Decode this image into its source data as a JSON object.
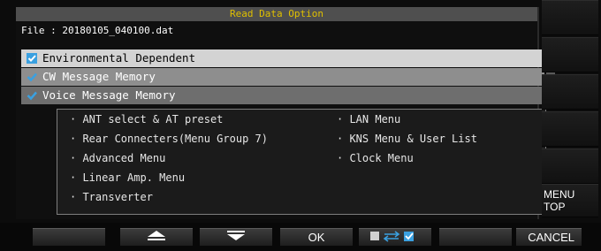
{
  "dialog": {
    "title": "Read Data Option",
    "file_line": "File : 20180105_040100.dat",
    "options": [
      {
        "label": "Environmental Dependent",
        "checked": true
      },
      {
        "label": "CW Message Memory",
        "checked": true
      },
      {
        "label": "Voice Message Memory",
        "checked": true
      }
    ],
    "info_items": [
      "· ANT select & AT preset",
      "· Rear Connecters(Menu Group 7)",
      "· Advanced Menu",
      "· Linear Amp. Menu",
      "· Transverter",
      "· LAN Menu",
      "· KNS Menu & User List",
      "· Clock Menu"
    ]
  },
  "side_keys": {
    "menu_top": "MENU\nTOP"
  },
  "bottom_keys": {
    "ok": "OK",
    "cancel": "CANCEL"
  },
  "colors": {
    "title_text": "#e0c000",
    "check_blue": "#3aa0e0"
  }
}
